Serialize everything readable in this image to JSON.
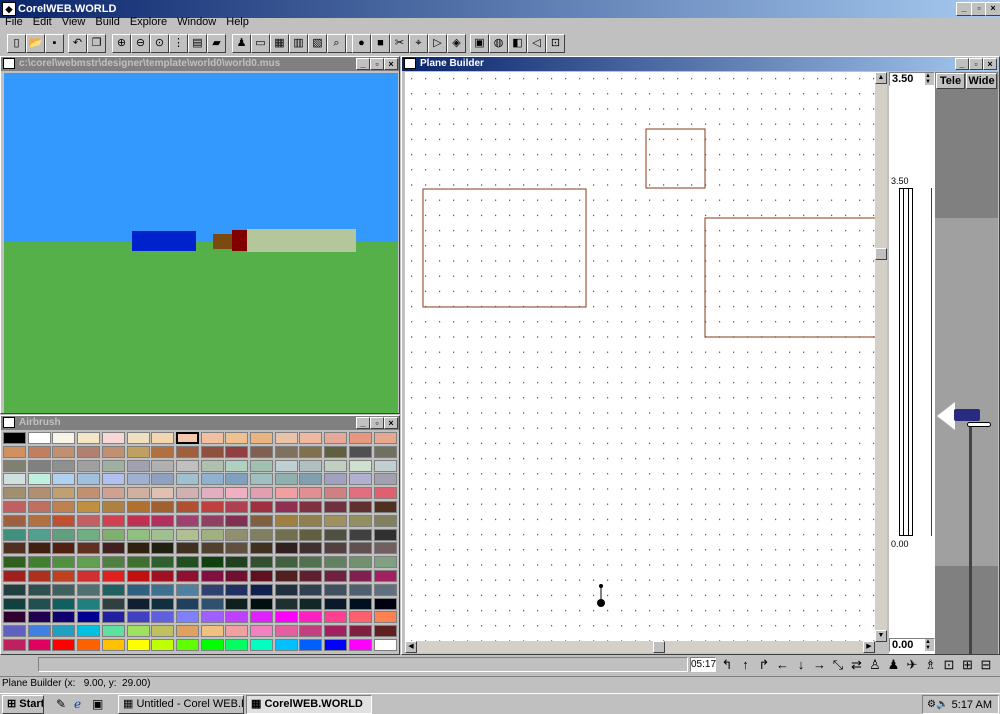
{
  "app": {
    "title": "CorelWEB.WORLD"
  },
  "menu": [
    "File",
    "Edit",
    "View",
    "Build",
    "Explore",
    "Window",
    "Help"
  ],
  "toolbar": {
    "icons": [
      "new-icon",
      "open-icon",
      "save-icon",
      "undo-icon",
      "copy-icon",
      "zoom-in-icon",
      "zoom-out-icon",
      "zoom-fit-icon",
      "grid-icon",
      "render-icon",
      "camera-icon",
      "person-icon",
      "box-icon",
      "texture-icon",
      "object-icon",
      "library-icon",
      "find-icon",
      "link-icon",
      "sphere-icon",
      "cube-icon",
      "scissors-icon",
      "transform-icon",
      "play-icon",
      "color-icon",
      "frame-icon",
      "globe-icon",
      "sound-icon",
      "speaker-icon",
      "export-icon"
    ]
  },
  "view_window": {
    "title": "c:\\corel\\webmstr\\designer\\template\\world0\\world0.mus"
  },
  "scene": {
    "sky": "#3399ff",
    "ground": "#55b04a"
  },
  "airbrush": {
    "title": "Airbrush"
  },
  "palette_colors": [
    [
      "#000000",
      "#ffffff",
      "#f7f3e6",
      "#f5e6c8",
      "#f8d7d7",
      "#efe0c0",
      "#f5d5b0",
      "#f4c8a8",
      "#f0c0a0",
      "#efc090",
      "#e8b480",
      "#e8c3a8",
      "#f0b8a0",
      "#e8a898",
      "#e89880",
      "#e8a890"
    ],
    [
      "#d09060",
      "#c08060",
      "#c09070",
      "#b08070",
      "#c09070",
      "#c0a060",
      "#b07040",
      "#a06040",
      "#905040",
      "#904040",
      "#806050",
      "#807060",
      "#807050",
      "#606040",
      "#505050",
      "#707060"
    ],
    [
      "#808070",
      "#808080",
      "#909090",
      "#a0a0a0",
      "#a0b0a0",
      "#a0a0b0",
      "#b0b0b0",
      "#c0c0c0",
      "#b0c0b0",
      "#b0d0c0",
      "#a0c0b0",
      "#c0d0d0",
      "#b0c0c0",
      "#c0d0c0",
      "#d0e0d0",
      "#c0d0d0"
    ],
    [
      "#d0e0e0",
      "#c0f0e0",
      "#b0d0f0",
      "#a0c0e0",
      "#b0c0f0",
      "#a0b0d0",
      "#90a0c0",
      "#a0c0d0",
      "#90b0d0",
      "#80a0c0",
      "#a0c0c0",
      "#90b0b0",
      "#80a0b0",
      "#a0a0c0",
      "#b0b0d0",
      "#a0a0b0"
    ],
    [
      "#a09070",
      "#b09070",
      "#c0a070",
      "#c09070",
      "#d0a090",
      "#d0b0a0",
      "#e0c0b0",
      "#d0b0b0",
      "#e0b0c0",
      "#f0b0c0",
      "#e0a0b0",
      "#f0a0a0",
      "#e09090",
      "#d08080",
      "#e07080",
      "#e06070"
    ],
    [
      "#c06060",
      "#c07060",
      "#c08050",
      "#c09040",
      "#b08040",
      "#b07030",
      "#a06030",
      "#b05030",
      "#c04040",
      "#b04050",
      "#a03040",
      "#903050",
      "#803040",
      "#703040",
      "#603030",
      "#503020"
    ],
    [
      "#a06040",
      "#b07040",
      "#c05030",
      "#c06060",
      "#d04050",
      "#c03050",
      "#b03060",
      "#a04070",
      "#904060",
      "#803050",
      "#806040",
      "#a08040",
      "#908050",
      "#a09060",
      "#909060",
      "#808060"
    ],
    [
      "#409080",
      "#50a090",
      "#60a080",
      "#70b080",
      "#80b070",
      "#90c080",
      "#a0c090",
      "#b0c090",
      "#a0b080",
      "#909070",
      "#808060",
      "#707050",
      "#606040",
      "#505040",
      "#404040",
      "#303030"
    ],
    [
      "#503020",
      "#402010",
      "#502010",
      "#603020",
      "#402020",
      "#302010",
      "#202010",
      "#403020",
      "#504030",
      "#605040",
      "#403020",
      "#302020",
      "#403030",
      "#504040",
      "#605050",
      "#706060"
    ],
    [
      "#306020",
      "#408030",
      "#509040",
      "#60a050",
      "#508040",
      "#407030",
      "#306030",
      "#205020",
      "#104010",
      "#204020",
      "#305030",
      "#406040",
      "#507050",
      "#608060",
      "#709070",
      "#80a080"
    ],
    [
      "#a02020",
      "#b03020",
      "#c04020",
      "#d03030",
      "#e02020",
      "#c01010",
      "#a01020",
      "#901030",
      "#801040",
      "#701030",
      "#601020",
      "#502020",
      "#602030",
      "#702040",
      "#802050",
      "#a02060"
    ],
    [
      "#204040",
      "#305050",
      "#406060",
      "#507070",
      "#206060",
      "#306080",
      "#407090",
      "#5080a0",
      "#304070",
      "#203060",
      "#102050",
      "#203040",
      "#304050",
      "#405060",
      "#506070",
      "#607080"
    ],
    [
      "#104040",
      "#205050",
      "#106060",
      "#208080",
      "#304040",
      "#102030",
      "#103040",
      "#204060",
      "#305070",
      "#102020",
      "#001010",
      "#203030",
      "#102828",
      "#0a1a2a",
      "#001020",
      "#000010"
    ],
    [
      "#300030",
      "#200050",
      "#100070",
      "#000090",
      "#2020a0",
      "#4040c0",
      "#6060e0",
      "#8080ff",
      "#a060ff",
      "#c040ff",
      "#e020ff",
      "#ff00ff",
      "#ff20c0",
      "#ff4090",
      "#ff6070",
      "#ff8050"
    ],
    [
      "#6060c0",
      "#4080e0",
      "#20a0c0",
      "#00c0e0",
      "#60e0a0",
      "#a0e060",
      "#c0c060",
      "#e0a060",
      "#f0c080",
      "#f0a0a0",
      "#f080c0",
      "#e060a0",
      "#c04080",
      "#a02060",
      "#802040",
      "#602020"
    ],
    [
      "#c02060",
      "#e00060",
      "#ff0000",
      "#ff6000",
      "#ffc000",
      "#ffff00",
      "#c0ff00",
      "#60ff00",
      "#00ff00",
      "#00ff60",
      "#00ffc0",
      "#00c0ff",
      "#0060ff",
      "#0000ff",
      "#ff00ff",
      "#ffffff"
    ]
  ],
  "plane_builder": {
    "title": "Plane Builder",
    "height_top": "3.50",
    "height_label_top": "3.50",
    "height_label_bottom": "0.00",
    "height_bottom": "0.00"
  },
  "camera": {
    "tele": "Tele",
    "wide": "Wide"
  },
  "time_field": "05:17",
  "nav_icons": [
    "turn-left-icon",
    "up-icon",
    "turn-right-icon",
    "left-icon",
    "down-icon",
    "right-icon",
    "tilt-icon",
    "pan-icon",
    "walk-icon",
    "stand-icon",
    "fly-icon",
    "person-icon",
    "view-icon",
    "fit-icon",
    "frame-icon"
  ],
  "status": {
    "text": "Plane Builder (x:   9.00, y:  29.00)"
  },
  "taskbar": {
    "start": "Start",
    "items": [
      "Untitled - Corel WEB.DESI...",
      "CorelWEB.WORLD"
    ],
    "clock": "5:17 AM"
  }
}
